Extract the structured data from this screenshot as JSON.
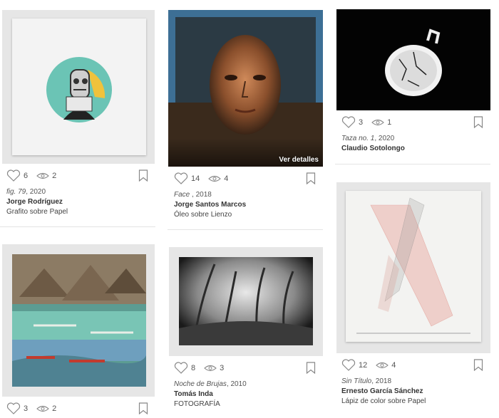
{
  "cards": [
    {
      "title": "fig. 79",
      "year": ", 2020",
      "artist": "Jorge Rodríguez",
      "medium": "Grafito sobre Papel",
      "likes": "6",
      "views": "2"
    },
    {
      "title": "Face",
      "year": " , 2018",
      "artist": "Jorge Santos Marcos",
      "medium": "Óleo sobre Lienzo",
      "likes": "14",
      "views": "4",
      "overlay": "Ver detalles"
    },
    {
      "title": "Taza no. 1",
      "year": ", 2020",
      "artist": "Claudio Sotolongo",
      "medium": "",
      "likes": "3",
      "views": "1"
    },
    {
      "title": "",
      "year": "",
      "artist": "",
      "medium": "",
      "likes": "3",
      "views": "2"
    },
    {
      "title": "Noche de Brujas",
      "year": ", 2010",
      "artist": "Tomás Inda",
      "medium": "FOTOGRAFÍA",
      "likes": "8",
      "views": "3"
    },
    {
      "title": "Sin Título",
      "year": ", 2018",
      "artist": "Ernesto García Sánchez",
      "medium": "Lápiz de color sobre Papel",
      "likes": "12",
      "views": "4"
    }
  ],
  "icons": {
    "like": "heart-icon",
    "view": "eye-icon",
    "save": "bookmark-icon"
  }
}
